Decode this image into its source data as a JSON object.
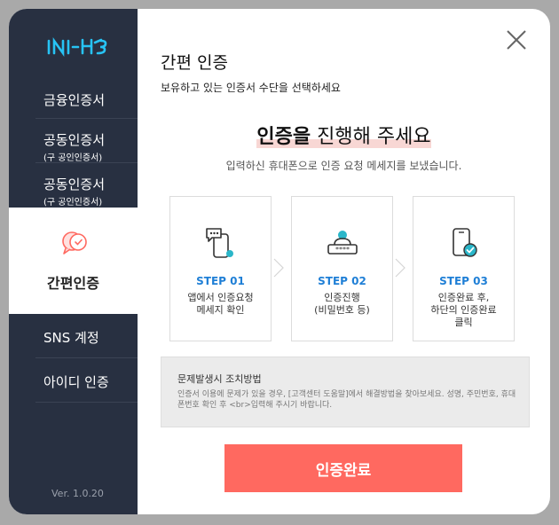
{
  "sidebar": {
    "logo": "INI-HUB",
    "items": [
      {
        "label": "금융인증서",
        "sub": ""
      },
      {
        "label": "공동인증서",
        "sub": "(구 공인인증서)"
      },
      {
        "label": "공동인증서",
        "sub": "(구 공인인증서)"
      },
      {
        "label": "SNS 계정",
        "sub": ""
      },
      {
        "label": "아이디 인증",
        "sub": ""
      }
    ],
    "active": {
      "label": "간편인증",
      "icon": "chat-bubbles-icon"
    },
    "version": "Ver. 1.0.20"
  },
  "content": {
    "title": "간편 인증",
    "subtitle": "보유하고 있는 인증서 수단을 선택하세요",
    "headline_bold": "인증을",
    "headline_rest": " 진행해 주세요",
    "description": "입력하신 휴대폰으로 인증 요청 메세지를 보냈습니다.",
    "steps": [
      {
        "name": "STEP 01",
        "desc": "앱에서 인증요청\n메세지 확인",
        "icon": "phone-message-icon"
      },
      {
        "name": "STEP 02",
        "desc": "인증진행\n(비밀번호 등)",
        "icon": "password-icon"
      },
      {
        "name": "STEP 03",
        "desc": "인증완료 후,\n하단의 인증완료\n클릭",
        "icon": "phone-check-icon"
      }
    ],
    "notice": {
      "title": "문제발생시 조치방법",
      "body": "인증서 이용에 문제가 있을 경우, [고객센터 도움말]에서 해결방법을 찾아보세요. 성명, 주민번호, 휴대폰번호 확인 후 <br>입력해 주시기 바랍니다."
    },
    "confirm_label": "인증완료"
  },
  "colors": {
    "sidebar_bg": "#283041",
    "accent_blue": "#1f7fd6",
    "icon_teal": "#2ab6c9",
    "confirm_red": "#ff6960",
    "highlight_pink": "#f8d7d4"
  }
}
